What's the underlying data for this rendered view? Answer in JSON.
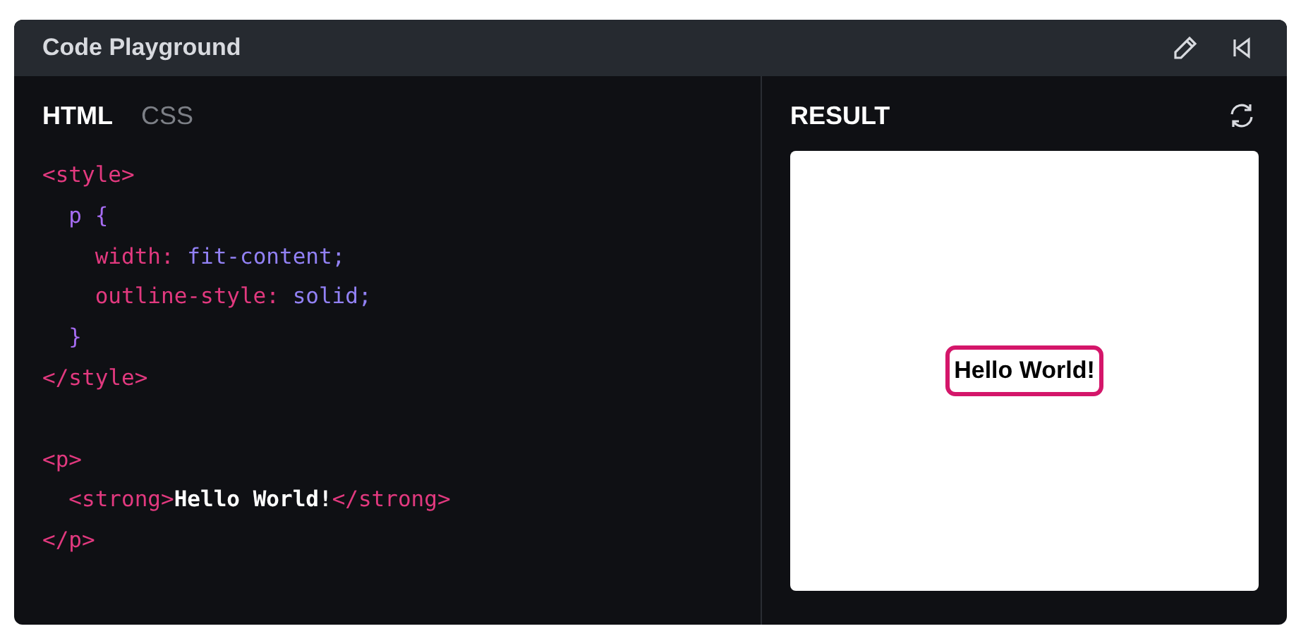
{
  "window": {
    "title": "Code Playground"
  },
  "tabs": [
    {
      "label": "HTML",
      "selected": true
    },
    {
      "label": "CSS",
      "selected": false
    }
  ],
  "code_blocks": [
    {
      "lines": [
        {
          "tokens": [
            {
              "kind": "tag",
              "text": "<style>"
            }
          ]
        },
        {
          "tokens": [
            {
              "kind": "selector",
              "text": "  p {"
            }
          ]
        },
        {
          "tokens": [
            {
              "kind": "property",
              "text": "    width:"
            },
            {
              "kind": "value",
              "text": " fit-content;"
            }
          ]
        },
        {
          "tokens": [
            {
              "kind": "property",
              "text": "    outline-style:"
            },
            {
              "kind": "value",
              "text": " solid;"
            }
          ]
        },
        {
          "tokens": [
            {
              "kind": "selector",
              "text": "  }"
            }
          ]
        },
        {
          "tokens": [
            {
              "kind": "tag",
              "text": "</style>"
            }
          ]
        }
      ]
    },
    {
      "lines": [
        {
          "tokens": [
            {
              "kind": "tag",
              "text": "<p>"
            }
          ]
        },
        {
          "tokens": [
            {
              "kind": "tag",
              "text": "  <strong>"
            },
            {
              "kind": "text",
              "text": "Hello World!"
            },
            {
              "kind": "tag",
              "text": "</strong>"
            }
          ]
        },
        {
          "tokens": [
            {
              "kind": "tag",
              "text": "</p>"
            }
          ]
        }
      ]
    }
  ],
  "result": {
    "title": "RESULT",
    "output_text": "Hello World!"
  }
}
